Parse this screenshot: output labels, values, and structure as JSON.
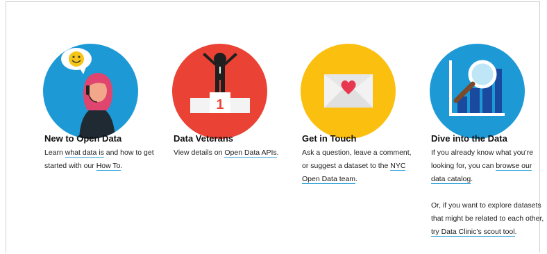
{
  "cards": [
    {
      "title": "New to Open Data",
      "icon": "person-smiley-icon",
      "color": "#1d9ad6",
      "p1": "Learn ",
      "link1": "what data is",
      "p2": " and how to get started with our ",
      "link2": "How To",
      "p3": "."
    },
    {
      "title": "Data Veterans",
      "icon": "podium-winner-icon",
      "color": "#ea4335",
      "p1": "View details on ",
      "link1": "Open Data APIs",
      "p2": "."
    },
    {
      "title": "Get in Touch",
      "icon": "envelope-heart-icon",
      "color": "#fbbf0f",
      "p1": "Ask a question, leave a comment, or suggest a dataset to the ",
      "link1": "NYC Open Data team",
      "p2": "."
    },
    {
      "title": "Dive into the Data",
      "icon": "chart-magnifier-icon",
      "color": "#1d9ad6",
      "p1": "If you already know what you’re looking for, you can ",
      "link1": "browse our data catalog",
      "p2": ".",
      "p3": "Or, if you want to explore datasets that might be related to each other, ",
      "link2": "try Data Clinic’s scout tool",
      "p4": "."
    }
  ]
}
